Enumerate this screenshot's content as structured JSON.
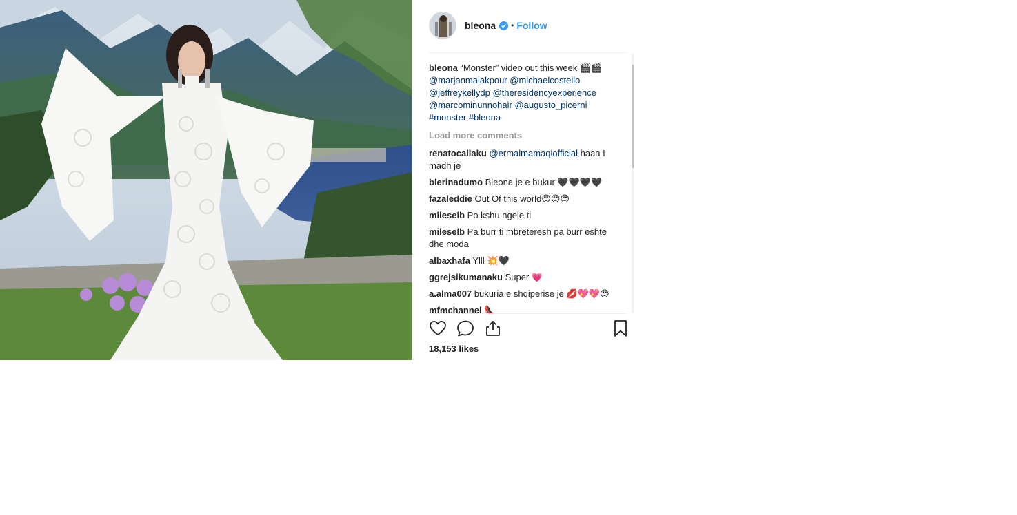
{
  "post": {
    "image_alt": "Woman in white lace gown on hillside above lake",
    "username": "bleona",
    "verified": true,
    "separator": "•",
    "follow_label": "Follow",
    "caption": {
      "user": "bleona",
      "text": "“Monster” video out this week 🎬🎬",
      "tags": [
        "@marjanmalakpour",
        "@michaelcostello",
        "@jeffreykellydp",
        "@theresidencyexperience",
        "@marcominunnohair",
        "@augusto_picerni",
        "#monster",
        "#bleona"
      ]
    },
    "load_more_label": "Load more comments",
    "comments": [
      {
        "user": "renatocallaku",
        "tag": "@ermalmamaqiofficial",
        "text": "haaa I madh je"
      },
      {
        "user": "blerinadumo",
        "tag": "",
        "text": "Bleona je e bukur 🖤🖤🖤🖤"
      },
      {
        "user": "fazaleddie",
        "tag": "",
        "text": "Out Of this world😍😍😍"
      },
      {
        "user": "mileselb",
        "tag": "",
        "text": "Po kshu ngele ti"
      },
      {
        "user": "mileselb",
        "tag": "",
        "text": "Pa burr ti mbreteresh pa burr eshte dhe moda"
      },
      {
        "user": "albaxhafa",
        "tag": "",
        "text": "Ylll 💥🖤"
      },
      {
        "user": "ggrejsikumanaku",
        "tag": "",
        "text": "Super 💗"
      },
      {
        "user": "a.alma007",
        "tag": "",
        "text": "bukuria e shqiperise je 💋💖💖😍"
      },
      {
        "user": "mfmchannel",
        "tag": "",
        "text": "👠"
      }
    ],
    "likes_label": "18,153 likes"
  },
  "icons": {
    "like": "heart-icon",
    "comment": "comment-icon",
    "share": "share-icon",
    "save": "bookmark-icon",
    "verified": "verified-badge-icon"
  },
  "colors": {
    "link_blue": "#3897f0",
    "tag_blue": "#003569",
    "muted_gray": "#999999",
    "verified_blue": "#3897f0"
  }
}
